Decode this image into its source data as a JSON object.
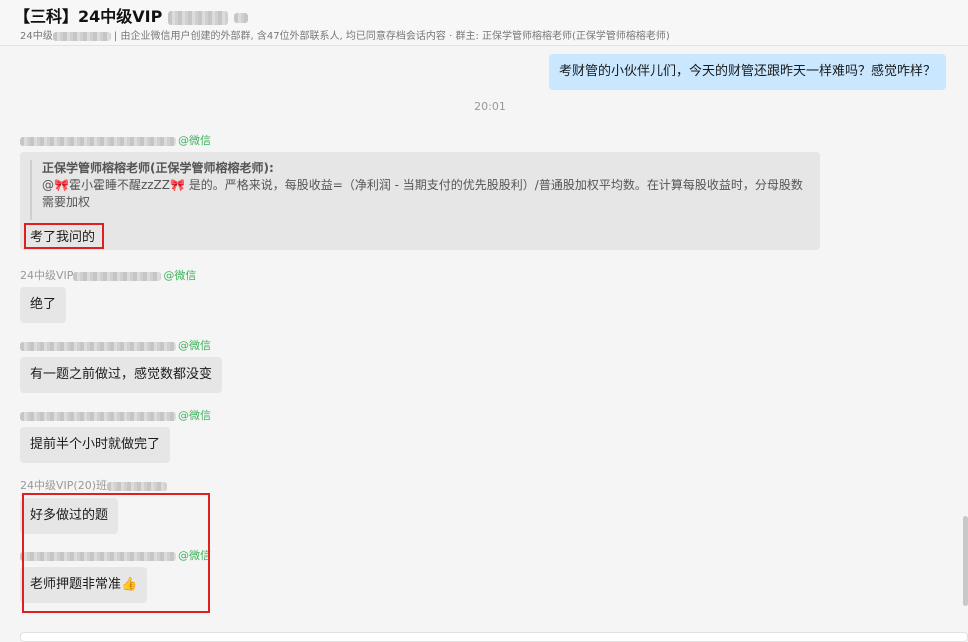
{
  "header": {
    "title": "【三科】24中级VIP",
    "subtitle_group": "24中级",
    "subtitle_info": "由企业微信用户创建的外部群, 含47位外部联系人, 均已同意存档会话内容",
    "subtitle_owner": "· 群主: 正保学管师榕榕老师(正保学管师榕榕老师)"
  },
  "messages": {
    "self_message": "考财管的小伙伴儿们，今天的财管还跟昨天一样难吗？感觉咋样？",
    "timestamp": "20:01",
    "quote": {
      "wechat_tag": "@微信",
      "author": "正保学管师榕榕老师(正保学管师榕榕老师):",
      "mention_prefix": "@",
      "mention_name": "霍小霍睡不醒zzZZ",
      "bow_icon": "🎀",
      "text": "是的。严格来说，每股收益=（净利润 - 当期支付的优先股股利）/普通股加权平均数。在计算每股收益时，分母股数需要加权",
      "reply": "考了我问的"
    },
    "sender2_label": "24中级VIP",
    "sender2_tag": "@微信",
    "msg2": "绝了",
    "sender3_tag": "@微信",
    "msg3": "有一题之前做过，感觉数都没变",
    "sender4_tag": "@微信",
    "msg4": "提前半个小时就做完了",
    "sender5_label": "24中级VIP(20)班",
    "msg5": "好多做过的题",
    "sender6_tag": "@微信",
    "msg6": "老师押题非常准",
    "thumbs_icon": "👍"
  },
  "colors": {
    "self_bubble": "#c9e7ff",
    "other_bubble": "#e6e6e6",
    "wechat_green": "#3cb35c",
    "highlight_red": "#e02020"
  }
}
